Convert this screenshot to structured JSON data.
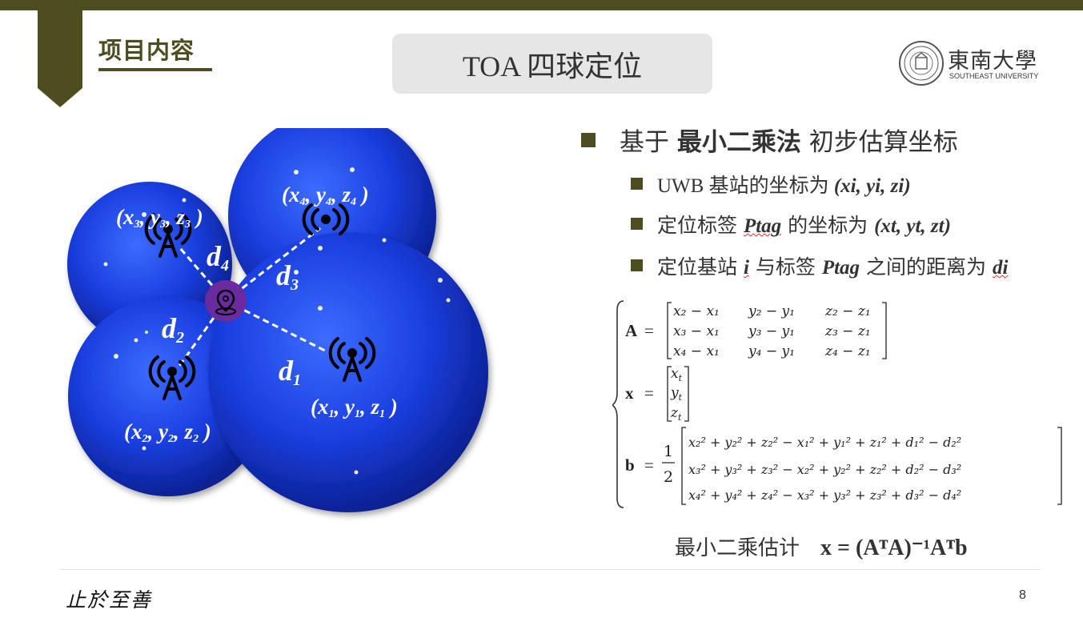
{
  "header": {
    "section_title": "项目内容",
    "slide_title": "TOA 四球定位"
  },
  "logo": {
    "cn": "東南大學",
    "en": "SOUTHEAST UNIVERSITY"
  },
  "figure": {
    "station_labels": [
      {
        "x": "x",
        "y": "y",
        "z": "z",
        "i": "1"
      },
      {
        "x": "x",
        "y": "y",
        "z": "z",
        "i": "2"
      },
      {
        "x": "x",
        "y": "y",
        "z": "z",
        "i": "3"
      },
      {
        "x": "x",
        "y": "y",
        "z": "z",
        "i": "4"
      }
    ],
    "distance_labels": [
      {
        "d": "d",
        "i": "1"
      },
      {
        "d": "d",
        "i": "2"
      },
      {
        "d": "d",
        "i": "3"
      },
      {
        "d": "d",
        "i": "4"
      }
    ]
  },
  "bullets": {
    "main_prefix": "基于 ",
    "main_bold": "最小二乘法",
    "main_suffix": " 初步估算坐标",
    "item1_text": "UWB 基站的坐标为 ",
    "item1_coord": "(xi, yi, zi)",
    "item2_text": "定位标签 ",
    "item2_sym": "Ptag",
    "item2_mid": " 的坐标为 ",
    "item2_coord": "(xt, yt, zt)",
    "item3_text": "定位基站 ",
    "item3_i": "i",
    "item3_mid": " 与标签 ",
    "item3_sym": "Ptag",
    "item3_end": " 之间的距离为 ",
    "item3_d": "di"
  },
  "formulas": {
    "A_label": "A",
    "x_label": "x",
    "b_label": "b",
    "final_label": "最小二乘估计",
    "final_eq": "x = (AᵀA)⁻¹Aᵀb"
  },
  "footer": {
    "motto": "止於至善",
    "page_number": "8"
  },
  "colors": {
    "accent": "#4d4d1f",
    "sphere": "#1a3fe0",
    "tag": "#6a2aa0"
  }
}
